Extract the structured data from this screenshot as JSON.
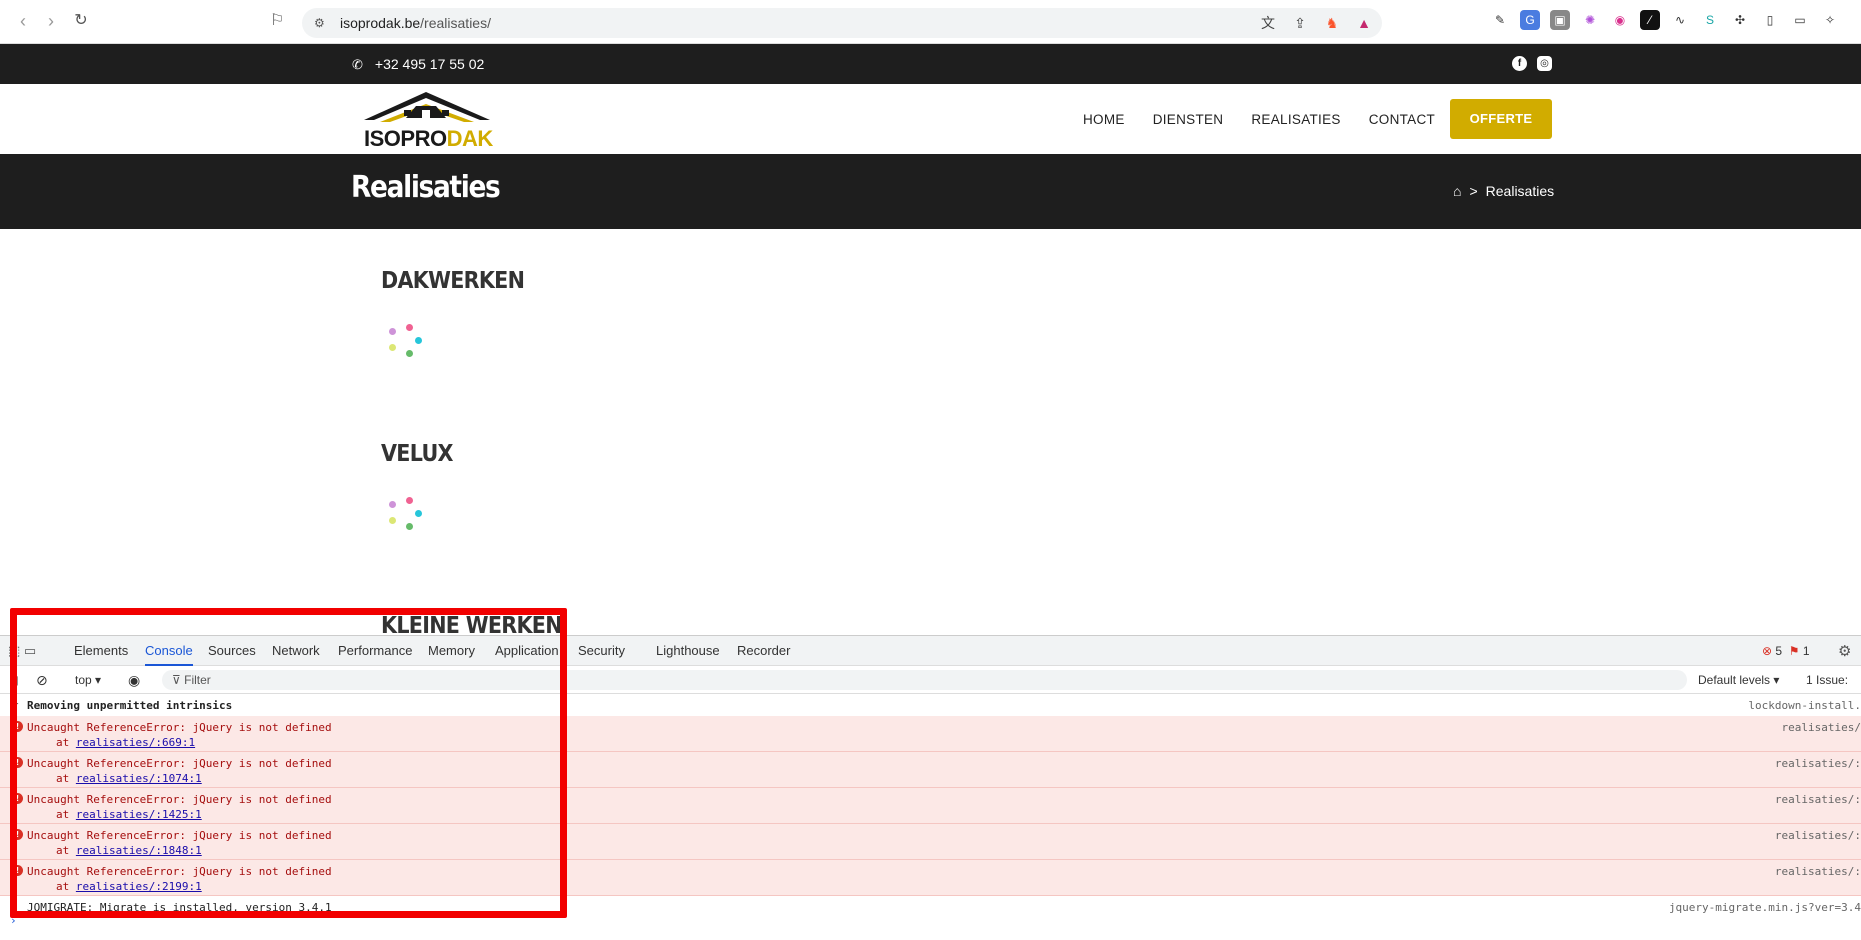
{
  "browser": {
    "url_host": "isoprodak.be",
    "url_path": "/realisaties/"
  },
  "topbar": {
    "phone": "+32 495 17 55 02"
  },
  "header": {
    "logo_part1": "ISOPRO",
    "logo_part2": "DAK",
    "nav": [
      "HOME",
      "DIENSTEN",
      "REALISATIES",
      "CONTACT"
    ],
    "cta": "OFFERTE"
  },
  "page": {
    "title": "Realisaties",
    "breadcrumb_sep": ">",
    "breadcrumb_current": "Realisaties",
    "sections": [
      "DAKWERKEN",
      "VELUX",
      "KLEINE WERKEN"
    ]
  },
  "colors": {
    "accent": "#d1ac00",
    "dark": "#1e1e1e",
    "highlight": "#f20000"
  },
  "devtools": {
    "tabs": [
      "Elements",
      "Console",
      "Sources",
      "Network",
      "Performance",
      "Memory",
      "Application",
      "Security",
      "Lighthouse",
      "Recorder"
    ],
    "active_tab": "Console",
    "error_count": "5",
    "issue_count": "1",
    "context": "top",
    "filter_placeholder": "Filter",
    "levels": "Default levels",
    "issues": "1 Issue:",
    "console": [
      {
        "type": "info",
        "text": "Removing unpermitted intrinsics",
        "src": "lockdown-install."
      },
      {
        "type": "error",
        "text": "Uncaught ReferenceError: jQuery is not defined",
        "at": "at ",
        "link": "realisaties/:669:1",
        "src": "realisaties/"
      },
      {
        "type": "error",
        "text": "Uncaught ReferenceError: jQuery is not defined",
        "at": "at ",
        "link": "realisaties/:1074:1",
        "src": "realisaties/:"
      },
      {
        "type": "error",
        "text": "Uncaught ReferenceError: jQuery is not defined",
        "at": "at ",
        "link": "realisaties/:1425:1",
        "src": "realisaties/:"
      },
      {
        "type": "error",
        "text": "Uncaught ReferenceError: jQuery is not defined",
        "at": "at ",
        "link": "realisaties/:1848:1",
        "src": "realisaties/:"
      },
      {
        "type": "error",
        "text": "Uncaught ReferenceError: jQuery is not defined",
        "at": "at ",
        "link": "realisaties/:2199:1",
        "src": "realisaties/:"
      },
      {
        "type": "log",
        "text": "JQMIGRATE: Migrate is installed, version 3.4.1",
        "src": "jquery-migrate.min.js?ver=3.4"
      }
    ]
  }
}
